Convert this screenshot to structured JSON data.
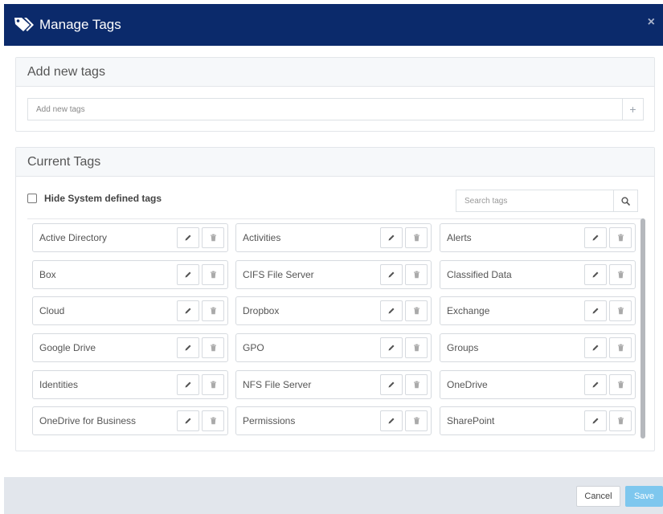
{
  "modal": {
    "title": "Manage Tags",
    "close_label": "×",
    "header_color": "#0b2a6b"
  },
  "add_panel": {
    "title": "Add new tags",
    "input_placeholder": "Add new tags",
    "add_label": "+"
  },
  "current_panel": {
    "title": "Current Tags",
    "hide_system_label": "Hide System defined tags",
    "search_placeholder": "Search tags"
  },
  "tags": [
    [
      "Active Directory",
      "Activities",
      "Alerts"
    ],
    [
      "Box",
      "CIFS File Server",
      "Classified Data"
    ],
    [
      "Cloud",
      "Dropbox",
      "Exchange"
    ],
    [
      "Google Drive",
      "GPO",
      "Groups"
    ],
    [
      "Identities",
      "NFS File Server",
      "OneDrive"
    ],
    [
      "OneDrive for Business",
      "Permissions",
      "SharePoint"
    ]
  ],
  "footer": {
    "cancel_label": "Cancel",
    "save_label": "Save",
    "save_color": "#7ec7ee"
  }
}
